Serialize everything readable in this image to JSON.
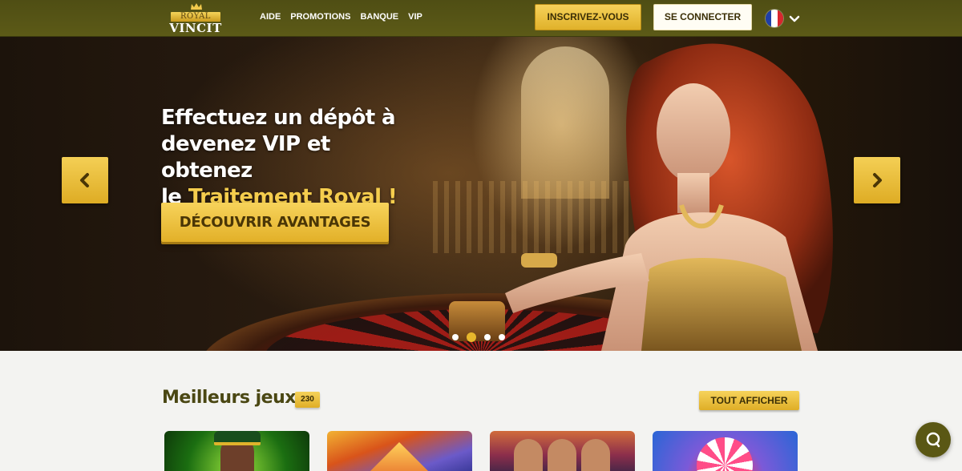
{
  "header": {
    "logo_top": "ROYAL",
    "logo_bottom": "VINCIT",
    "nav": [
      "AIDE",
      "PROMOTIONS",
      "BANQUE",
      "VIP"
    ],
    "register_label": "INSCRIVEZ-VOUS",
    "login_label": "SE CONNECTER",
    "language_flag": "france-flag-icon",
    "accent_color": "#f2c94c",
    "bar_color": "#555316"
  },
  "hero": {
    "line1": "Effectuez un dépôt à",
    "line2": "devenez VIP et obtenez",
    "line3_prefix": "le ",
    "line3_highlight": "Traitement Royal !",
    "cta_label": "DÉCOUVRIR AVANTAGES",
    "prev_icon": "chevron-left-icon",
    "next_icon": "chevron-right-icon",
    "slides_count": 4,
    "active_slide": 2
  },
  "games": {
    "title": "Meilleurs jeux",
    "count": "230",
    "show_all_label": "TOUT AFFICHER"
  },
  "chat": {
    "icon": "chat-bubble-icon"
  }
}
